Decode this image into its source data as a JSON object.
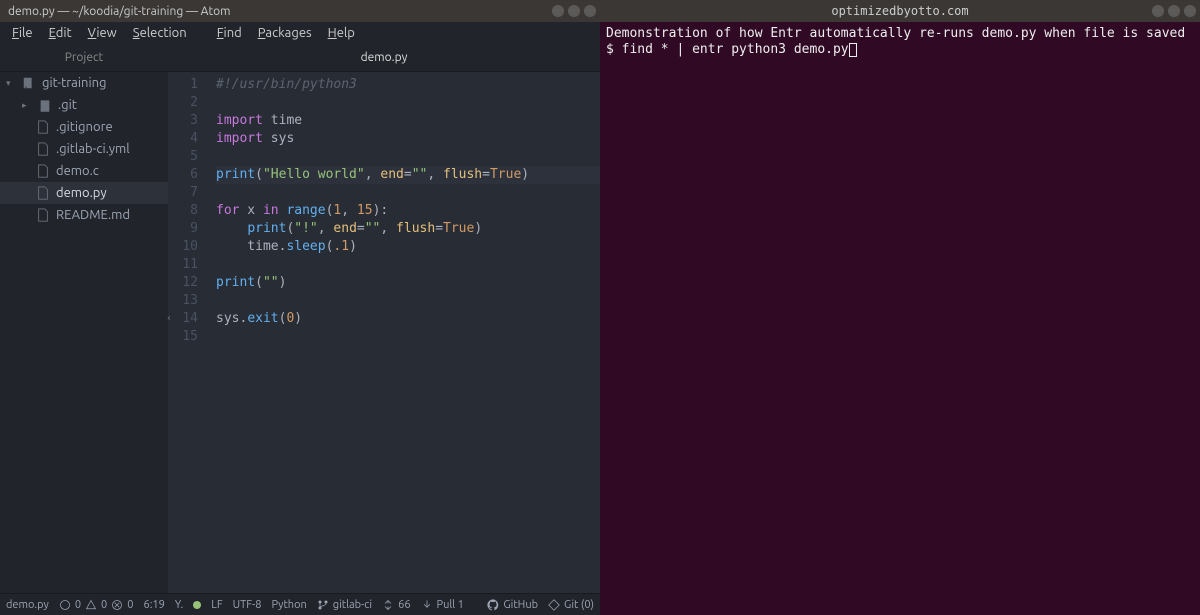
{
  "editor": {
    "titlebar": "demo.py — ~/koodia/git-training — Atom",
    "menu": [
      "File",
      "Edit",
      "View",
      "Selection",
      "Find",
      "Packages",
      "Help"
    ],
    "project_tab": "Project",
    "file_tab": "demo.py",
    "tree": {
      "root": "git-training",
      "items": [
        {
          "name": ".git",
          "type": "folder"
        },
        {
          "name": ".gitignore",
          "type": "file"
        },
        {
          "name": ".gitlab-ci.yml",
          "type": "file"
        },
        {
          "name": "demo.c",
          "type": "file"
        },
        {
          "name": "demo.py",
          "type": "file",
          "selected": true
        },
        {
          "name": "README.md",
          "type": "file"
        }
      ]
    },
    "code_lines": [
      {
        "n": 1,
        "tokens": [
          {
            "c": "cm",
            "t": "#!/usr/bin/python3"
          }
        ]
      },
      {
        "n": 2,
        "tokens": []
      },
      {
        "n": 3,
        "tokens": [
          {
            "c": "kw",
            "t": "import"
          },
          {
            "c": "nm",
            "t": " time"
          }
        ]
      },
      {
        "n": 4,
        "tokens": [
          {
            "c": "kw",
            "t": "import"
          },
          {
            "c": "nm",
            "t": " sys"
          }
        ]
      },
      {
        "n": 5,
        "tokens": []
      },
      {
        "n": 6,
        "hl": true,
        "tokens": [
          {
            "c": "fn",
            "t": "print"
          },
          {
            "c": "op",
            "t": "("
          },
          {
            "c": "str",
            "t": "\"Hello world\""
          },
          {
            "c": "op",
            "t": ", "
          },
          {
            "c": "biv",
            "t": "end"
          },
          {
            "c": "op",
            "t": "="
          },
          {
            "c": "str",
            "t": "\"\""
          },
          {
            "c": "op",
            "t": ", "
          },
          {
            "c": "biv",
            "t": "flush"
          },
          {
            "c": "op",
            "t": "="
          },
          {
            "c": "bool",
            "t": "True"
          },
          {
            "c": "op",
            "t": ")"
          }
        ]
      },
      {
        "n": 7,
        "tokens": []
      },
      {
        "n": 8,
        "tokens": [
          {
            "c": "kw",
            "t": "for"
          },
          {
            "c": "nm",
            "t": " x "
          },
          {
            "c": "kw",
            "t": "in"
          },
          {
            "c": "nm",
            "t": " "
          },
          {
            "c": "fn",
            "t": "range"
          },
          {
            "c": "op",
            "t": "("
          },
          {
            "c": "num",
            "t": "1"
          },
          {
            "c": "op",
            "t": ", "
          },
          {
            "c": "num",
            "t": "15"
          },
          {
            "c": "op",
            "t": "):"
          }
        ]
      },
      {
        "n": 9,
        "tokens": [
          {
            "c": "nm",
            "t": "    "
          },
          {
            "c": "fn",
            "t": "print"
          },
          {
            "c": "op",
            "t": "("
          },
          {
            "c": "str",
            "t": "\"!\""
          },
          {
            "c": "op",
            "t": ", "
          },
          {
            "c": "biv",
            "t": "end"
          },
          {
            "c": "op",
            "t": "="
          },
          {
            "c": "str",
            "t": "\"\""
          },
          {
            "c": "op",
            "t": ", "
          },
          {
            "c": "biv",
            "t": "flush"
          },
          {
            "c": "op",
            "t": "="
          },
          {
            "c": "bool",
            "t": "True"
          },
          {
            "c": "op",
            "t": ")"
          }
        ]
      },
      {
        "n": 10,
        "tokens": [
          {
            "c": "nm",
            "t": "    time"
          },
          {
            "c": "op",
            "t": "."
          },
          {
            "c": "fn",
            "t": "sleep"
          },
          {
            "c": "op",
            "t": "("
          },
          {
            "c": "num",
            "t": ".1"
          },
          {
            "c": "op",
            "t": ")"
          }
        ]
      },
      {
        "n": 11,
        "tokens": []
      },
      {
        "n": 12,
        "tokens": [
          {
            "c": "fn",
            "t": "print"
          },
          {
            "c": "op",
            "t": "("
          },
          {
            "c": "str",
            "t": "\"\""
          },
          {
            "c": "op",
            "t": ")"
          }
        ]
      },
      {
        "n": 13,
        "tokens": []
      },
      {
        "n": 14,
        "tokens": [
          {
            "c": "nm",
            "t": "sys"
          },
          {
            "c": "op",
            "t": "."
          },
          {
            "c": "fn",
            "t": "exit"
          },
          {
            "c": "op",
            "t": "("
          },
          {
            "c": "num",
            "t": "0"
          },
          {
            "c": "op",
            "t": ")"
          }
        ]
      },
      {
        "n": 15,
        "tokens": []
      }
    ],
    "status": {
      "file": "demo.py",
      "diagnostics": "0",
      "cursor": "6:19",
      "selection": "Y.",
      "eol": "LF",
      "encoding": "UTF-8",
      "lang": "Python",
      "branch": "gitlab-ci",
      "fetch": "66",
      "pull": "Pull 1",
      "github": "GitHub",
      "git": "Git (0)"
    }
  },
  "terminal": {
    "title": "optimizedbyotto.com",
    "lines": [
      "Demonstration of how Entr automatically re-runs demo.py when file is saved",
      "$ find * | entr python3 demo.py"
    ]
  }
}
